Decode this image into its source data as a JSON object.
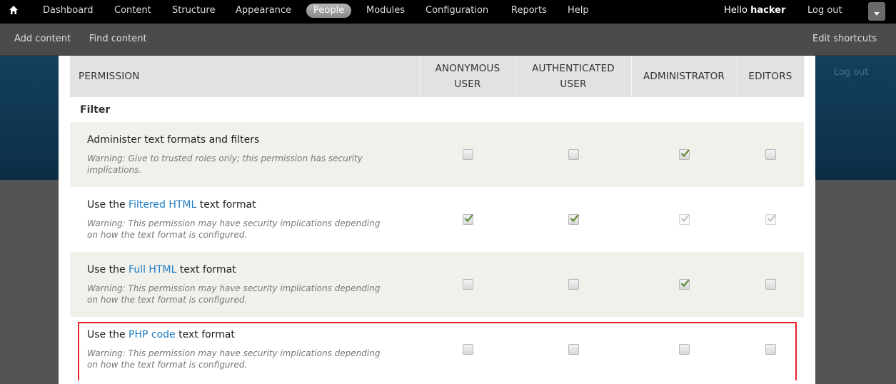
{
  "toolbar": {
    "home_icon": "home-icon",
    "menu": [
      {
        "label": "Dashboard",
        "active": false
      },
      {
        "label": "Content",
        "active": false
      },
      {
        "label": "Structure",
        "active": false
      },
      {
        "label": "Appearance",
        "active": false
      },
      {
        "label": "People",
        "active": true
      },
      {
        "label": "Modules",
        "active": false
      },
      {
        "label": "Configuration",
        "active": false
      },
      {
        "label": "Reports",
        "active": false
      },
      {
        "label": "Help",
        "active": false
      }
    ],
    "hello_prefix": "Hello ",
    "username": "hacker",
    "logout_label": "Log out",
    "toggle_icon": "chevron-down-icon"
  },
  "shortcuts": {
    "items": [
      "Add content",
      "Find content"
    ],
    "edit_label": "Edit shortcuts"
  },
  "background": {
    "logout_label": "Log out"
  },
  "table": {
    "headers": {
      "permission": "PERMISSION",
      "anonymous": "ANONYMOUS USER",
      "authenticated": "AUTHENTICATED USER",
      "administrator": "ADMINISTRATOR",
      "editors": "EDITORS"
    },
    "module": "Filter",
    "rows": [
      {
        "title_pre": "Administer text formats and filters",
        "link": "",
        "title_post": "",
        "warning": "Warning: Give to trusted roles only; this permission has security implications.",
        "checks": [
          "unchecked",
          "unchecked",
          "checked",
          "unchecked"
        ]
      },
      {
        "title_pre": "Use the ",
        "link": "Filtered HTML",
        "title_post": " text format",
        "warning": "Warning: This permission may have security implications depending on how the text format is configured.",
        "checks": [
          "checked",
          "checked",
          "disabled-checked",
          "disabled-checked"
        ]
      },
      {
        "title_pre": "Use the ",
        "link": "Full HTML",
        "title_post": " text format",
        "warning": "Warning: This permission may have security implications depending on how the text format is configured.",
        "checks": [
          "unchecked",
          "unchecked",
          "checked",
          "unchecked"
        ]
      },
      {
        "title_pre": "Use the ",
        "link": "PHP code",
        "title_post": " text format",
        "warning": "Warning: This permission may have security implications depending on how the text format is configured.",
        "checks": [
          "unchecked",
          "unchecked",
          "unchecked",
          "unchecked"
        ]
      }
    ]
  },
  "colors": {
    "toolbar_bg": "#000000",
    "header_blue": "#0f3650",
    "link_blue": "#1e7bc2",
    "highlight_red": "#e4202a",
    "check_green": "#5e8c3a"
  }
}
